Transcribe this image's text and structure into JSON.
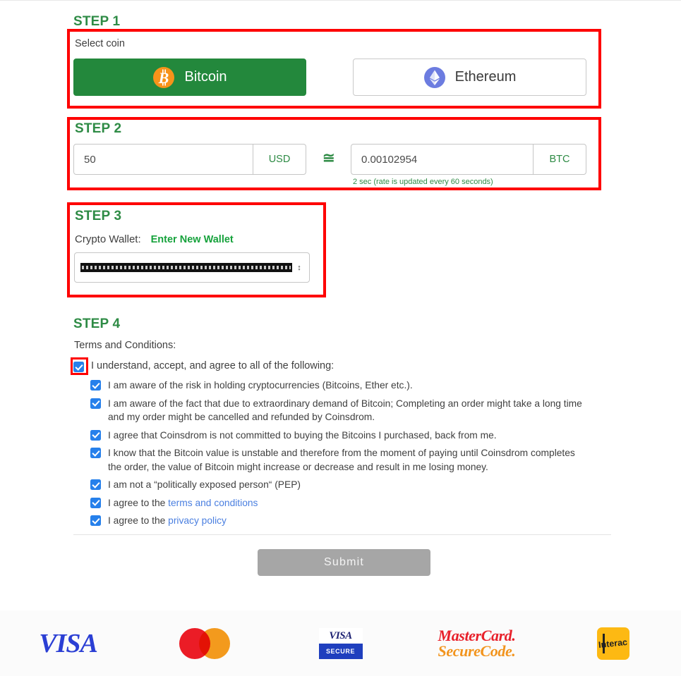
{
  "step1": {
    "title": "STEP 1",
    "select_label": "Select coin",
    "coins": [
      {
        "name": "Bitcoin",
        "icon": "bitcoin-icon",
        "selected": true
      },
      {
        "name": "Ethereum",
        "icon": "ethereum-icon",
        "selected": false
      }
    ]
  },
  "step2": {
    "title": "STEP 2",
    "fiat_value": "50",
    "fiat_placeholder": "50",
    "fiat_currency": "USD",
    "approx_symbol": "≅",
    "crypto_value": "0.00102954",
    "crypto_placeholder": "0.00102954",
    "crypto_currency": "BTC",
    "rate_note": "2 sec (rate is updated every 60 seconds)"
  },
  "step3": {
    "title": "STEP 3",
    "wallet_label": "Crypto Wallet:",
    "new_wallet_link": "Enter New Wallet",
    "selected_wallet": "",
    "wallet_redacted": true
  },
  "step4": {
    "title": "STEP 4",
    "terms_heading": "Terms and Conditions:",
    "master_checkbox": {
      "label": "I understand, accept, and agree to all of the following:",
      "checked": true,
      "highlighted": true
    },
    "items": [
      {
        "checked": true,
        "text": "I am aware of the risk in holding cryptocurrencies (Bitcoins, Ether etc.)."
      },
      {
        "checked": true,
        "text": "I am aware of the fact that due to extraordinary demand of Bitcoin; Completing an order might take a long time and my order might be cancelled and refunded by Coinsdrom."
      },
      {
        "checked": true,
        "text": "I agree that Coinsdrom is not committed to buying the Bitcoins I purchased, back from me."
      },
      {
        "checked": true,
        "text": "I know that the Bitcoin value is unstable and therefore from the moment of paying until Coinsdrom completes the order, the value of Bitcoin might increase or decrease and result in me losing money."
      },
      {
        "checked": true,
        "text": "I am not a “politically exposed person“ (PEP)"
      },
      {
        "checked": true,
        "text_before": "I agree to the ",
        "link": "terms and conditions",
        "text_after": ""
      },
      {
        "checked": true,
        "text_before": "I agree to the ",
        "link": "privacy policy",
        "text_after": ""
      }
    ]
  },
  "submit": {
    "label": "Submit",
    "enabled": false
  },
  "footer": {
    "logos": [
      {
        "name": "visa-logo",
        "text": "VISA"
      },
      {
        "name": "mastercard-logo",
        "text": ""
      },
      {
        "name": "verified-by-visa-logo",
        "top": "VISA",
        "bottom": "SECURE"
      },
      {
        "name": "mastercard-securecode-logo",
        "line1": "MasterCard.",
        "line2": "SecureCode."
      },
      {
        "name": "interac-logo",
        "text": "Interac"
      }
    ]
  },
  "colors": {
    "brand_green": "#23883c",
    "step_title_green": "#2e8b45",
    "highlight_red": "#fe0000",
    "checkbox_blue": "#2680eb",
    "link_blue": "#4a7fe0",
    "submit_gray": "#a6a6a6"
  }
}
